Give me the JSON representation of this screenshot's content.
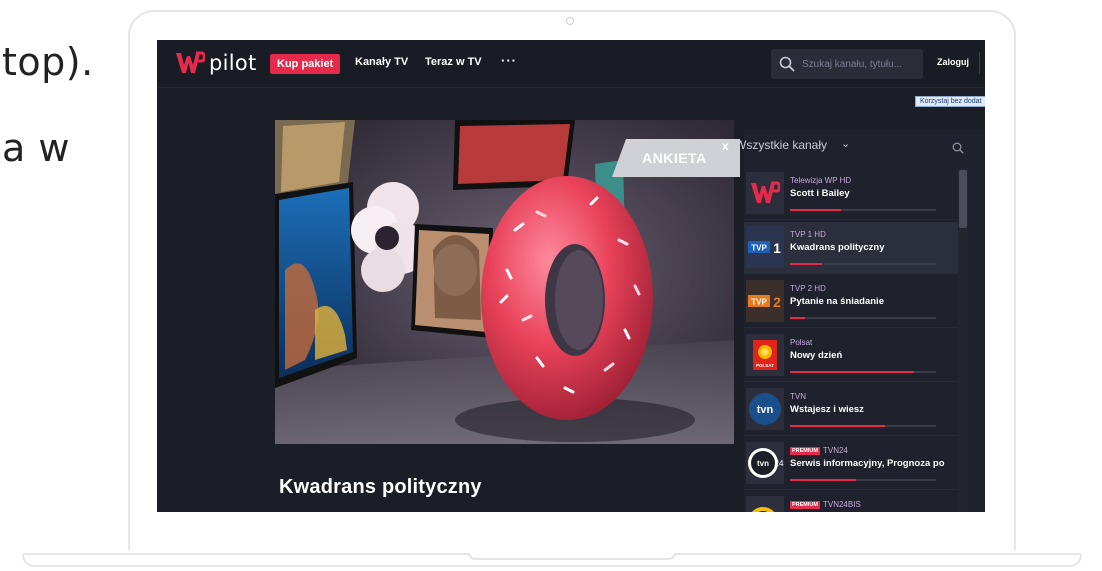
{
  "background": {
    "line1": "top).",
    "line2": "a w"
  },
  "app": {
    "logo_text": "pilot",
    "brand_color": "#e52a4c"
  },
  "nav": {
    "buy_package": "Kup pakiet",
    "channels": "Kanały TV",
    "now_on_tv": "Teraz w TV",
    "more": "···",
    "search_placeholder": "Szukaj kanału, tytułu...",
    "login": "Zaloguj",
    "free_tip": "Korzystaj bez dodat"
  },
  "player": {
    "survey_label": "ANKIETA",
    "survey_close": "x",
    "program_title": "Kwadrans polityczny"
  },
  "sidebar": {
    "header": "Wszystkie kanały",
    "chevron": "⌄",
    "channels": [
      {
        "channel": "Telewizja WP HD",
        "show": "Scott i Bailey",
        "progress": 0.35,
        "premium": false,
        "logo": "wp",
        "active": false
      },
      {
        "channel": "TVP 1 HD",
        "show": "Kwadrans polityczny",
        "progress": 0.22,
        "premium": false,
        "logo": "tvp1",
        "active": true
      },
      {
        "channel": "TVP 2 HD",
        "show": "Pytanie na śniadanie",
        "progress": 0.1,
        "premium": false,
        "logo": "tvp2",
        "active": false
      },
      {
        "channel": "Polsat",
        "show": "Nowy dzień",
        "progress": 0.85,
        "premium": false,
        "logo": "polsat",
        "active": false
      },
      {
        "channel": "TVN",
        "show": "Wstajesz i wiesz",
        "progress": 0.65,
        "premium": false,
        "logo": "tvn",
        "active": false
      },
      {
        "channel": "TVN24",
        "show": "Serwis informacyjny, Prognoza po",
        "progress": 0.45,
        "premium": true,
        "premium_label": "PREMIUM",
        "logo": "tvn24",
        "active": false
      },
      {
        "channel": "TVN24BIS",
        "show": "",
        "progress": 0,
        "premium": true,
        "premium_label": "PREMIUM",
        "logo": "tvn24bis",
        "active": false
      }
    ]
  }
}
